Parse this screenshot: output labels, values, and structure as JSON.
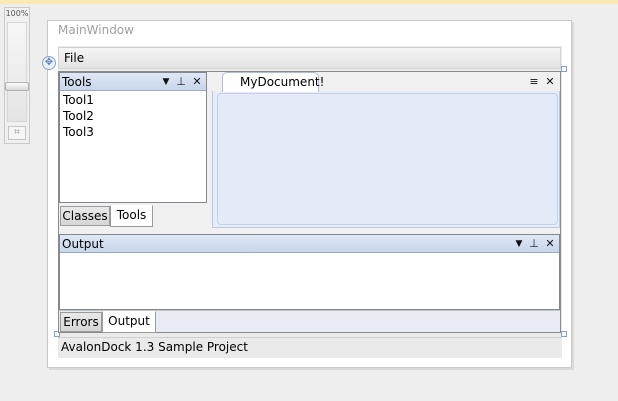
{
  "zoom": {
    "level": "100%"
  },
  "window": {
    "title": "MainWindow"
  },
  "menu": {
    "file": "File"
  },
  "tools_pane": {
    "title": "Tools",
    "items": [
      "Tool1",
      "Tool2",
      "Tool3"
    ],
    "tabs": [
      "Classes",
      "Tools"
    ]
  },
  "document": {
    "tab_label": "MyDocument!"
  },
  "output_pane": {
    "title": "Output",
    "tabs": [
      "Errors",
      "Output"
    ]
  },
  "status": {
    "text": "AvalonDock 1.3 Sample Project"
  },
  "icons": {
    "dropdown": "▼",
    "pin": "⊥",
    "close": "✕",
    "doc_list": "≡"
  }
}
